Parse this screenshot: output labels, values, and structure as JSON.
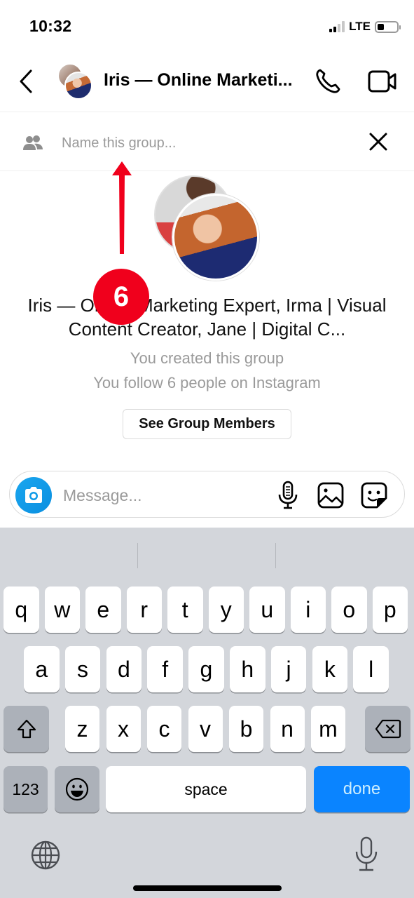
{
  "status_bar": {
    "time": "10:32",
    "network": "LTE",
    "signal_bars_active": 2,
    "signal_bars_total": 4,
    "battery_level": 0.25
  },
  "header": {
    "back_icon": "chevron-left-icon",
    "title": "Iris — Online Marketi...",
    "call_icon": "phone-icon",
    "video_icon": "video-camera-icon"
  },
  "group_name": {
    "icon": "group-people-icon",
    "placeholder": "Name this group...",
    "value": "",
    "close_icon": "close-icon"
  },
  "group_info": {
    "title": "Iris — Online Marketing Expert, Irma | Visual Content Creator, Jane | Digital C...",
    "created_text": "You created this group",
    "follow_text": "You follow 6 people on Instagram",
    "members_button": "See Group Members"
  },
  "annotation": {
    "step_number": "6",
    "color": "#f0001c"
  },
  "composer": {
    "camera_icon": "camera-icon",
    "placeholder": "Message...",
    "mic_icon": "microphone-icon",
    "gallery_icon": "image-gallery-icon",
    "sticker_icon": "sticker-icon",
    "accent_color": "#0f9be8"
  },
  "keyboard": {
    "row1": [
      "q",
      "w",
      "e",
      "r",
      "t",
      "y",
      "u",
      "i",
      "o",
      "p"
    ],
    "row2": [
      "a",
      "s",
      "d",
      "f",
      "g",
      "h",
      "j",
      "k",
      "l"
    ],
    "row3": [
      "z",
      "x",
      "c",
      "v",
      "b",
      "n",
      "m"
    ],
    "shift_icon": "shift-icon",
    "backspace_icon": "backspace-icon",
    "numbers_label": "123",
    "emoji_icon": "emoji-icon",
    "space_label": "space",
    "done_label": "done",
    "globe_icon": "globe-icon",
    "dictation_icon": "dictation-mic-icon",
    "done_color": "#0a84ff"
  }
}
